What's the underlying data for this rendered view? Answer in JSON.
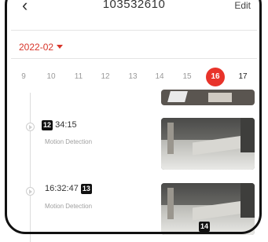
{
  "header": {
    "title": "103532610",
    "back_icon": "chevron-left-icon",
    "edit_label": "Edit"
  },
  "month": {
    "label": "2022-02"
  },
  "dates": [
    {
      "label": "9"
    },
    {
      "label": "10"
    },
    {
      "label": "11"
    },
    {
      "label": "12"
    },
    {
      "label": "13"
    },
    {
      "label": "14"
    },
    {
      "label": "15"
    },
    {
      "label": "16",
      "selected": true
    },
    {
      "label": "17"
    }
  ],
  "events": [
    {
      "badge": "12",
      "time": "34:15",
      "type": "Motion Detection"
    },
    {
      "time": "16:32:47",
      "badge": "13",
      "type": "Motion Detection",
      "thumb_badge": "14"
    }
  ],
  "colors": {
    "accent": "#e8332a",
    "text": "#333333",
    "muted": "#a0a0a0"
  }
}
